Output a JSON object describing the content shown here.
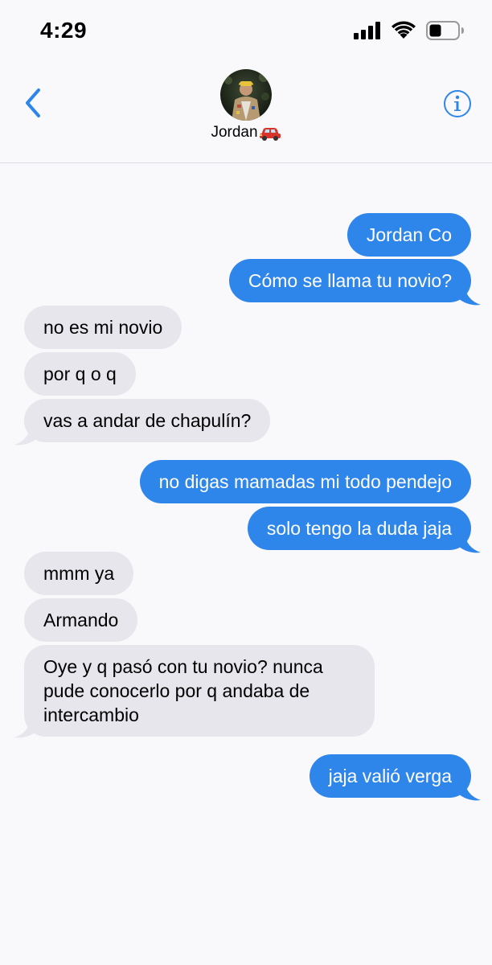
{
  "status_bar": {
    "time": "4:29"
  },
  "header": {
    "contact_name": "Jordan",
    "contact_emoji_icon": "red-car-icon",
    "back_icon": "chevron-left-icon",
    "info_icon": "info-circle-icon"
  },
  "colors": {
    "outgoing_bubble": "#2f86ea",
    "incoming_bubble": "#e7e6ec",
    "accent": "#2f86ea",
    "background": "#f9f9fb"
  },
  "messages": [
    {
      "direction": "out",
      "text": "Jordan Co"
    },
    {
      "direction": "out",
      "text": "Cómo se llama tu novio?"
    },
    {
      "direction": "in",
      "text": "no es mi novio"
    },
    {
      "direction": "in",
      "text": "por q o q"
    },
    {
      "direction": "in",
      "text": "vas a andar de chapulín?"
    },
    {
      "direction": "out",
      "text": "no digas mamadas mi todo pendejo"
    },
    {
      "direction": "out",
      "text": "solo tengo la duda jaja"
    },
    {
      "direction": "in",
      "text": "mmm ya"
    },
    {
      "direction": "in",
      "text": "Armando"
    },
    {
      "direction": "in",
      "text": "Oye y q pasó con tu novio? nunca pude conocerlo por q andaba de intercambio"
    },
    {
      "direction": "out",
      "text": "jaja valió verga"
    }
  ]
}
